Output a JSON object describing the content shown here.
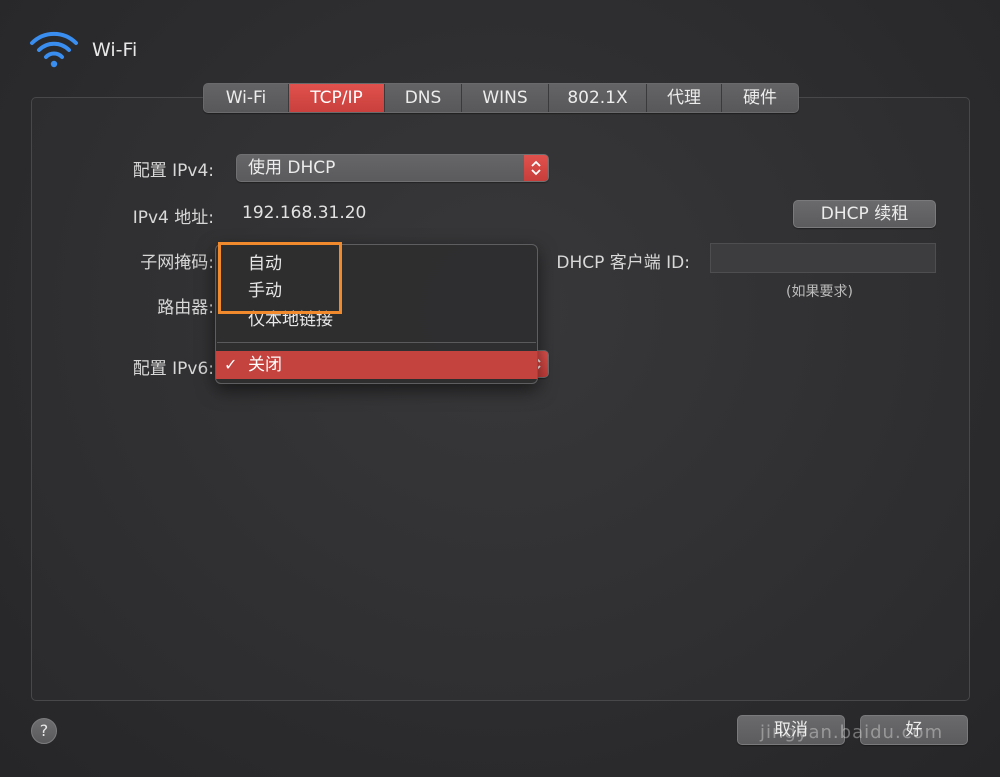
{
  "header": {
    "title": "Wi-Fi",
    "icon": "wifi-icon"
  },
  "tabs": [
    {
      "label": "Wi-Fi",
      "active": false
    },
    {
      "label": "TCP/IP",
      "active": true
    },
    {
      "label": "DNS",
      "active": false
    },
    {
      "label": "WINS",
      "active": false
    },
    {
      "label": "802.1X",
      "active": false
    },
    {
      "label": "代理",
      "active": false
    },
    {
      "label": "硬件",
      "active": false
    }
  ],
  "ipv4": {
    "config_label": "配置 IPv4:",
    "config_value": "使用 DHCP",
    "address_label": "IPv4 地址:",
    "address_value": "192.168.31.20",
    "renew_button": "DHCP 续租",
    "subnet_label": "子网掩码:",
    "router_label": "路由器:",
    "client_id_label": "DHCP 客户端 ID:",
    "client_id_value": "",
    "client_id_hint": "(如果要求)"
  },
  "ipv6": {
    "config_label": "配置 IPv6:"
  },
  "ipv6_menu": {
    "items": [
      {
        "label": "自动",
        "selected": false
      },
      {
        "label": "手动",
        "selected": false
      },
      {
        "label": "仅本地链接",
        "selected": false
      },
      {
        "label": "关闭",
        "selected": true
      }
    ],
    "check_glyph": "✓"
  },
  "footer": {
    "help": "?",
    "cancel": "取消",
    "ok": "好",
    "watermark": "jingyan.baidu.com"
  },
  "colors": {
    "accent": "#c9403c",
    "highlight": "#f08a2c",
    "background": "#2b2b2d"
  }
}
